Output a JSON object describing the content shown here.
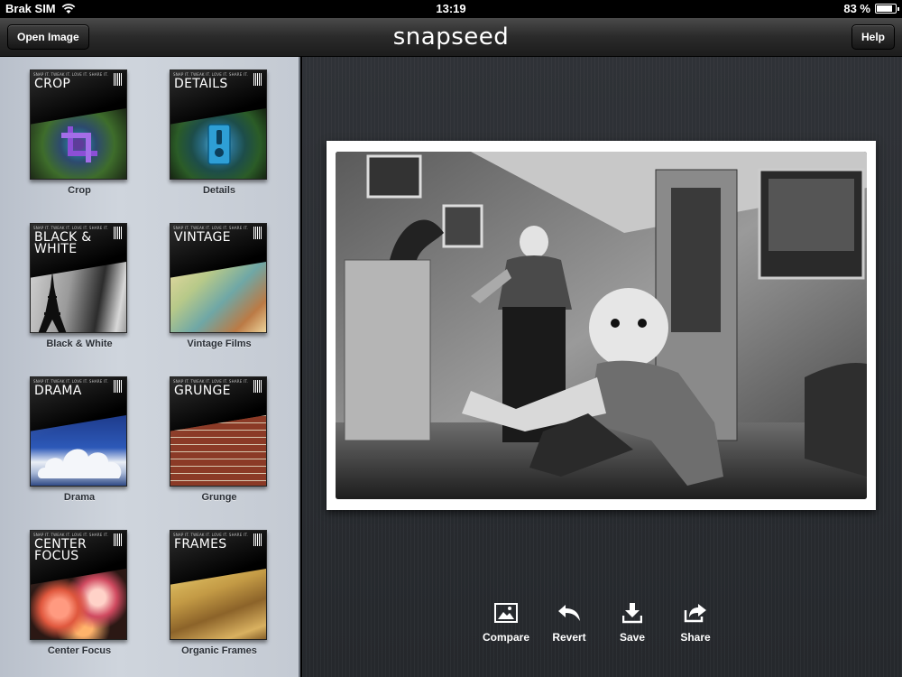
{
  "status_bar": {
    "carrier": "Brak SIM",
    "time": "13:19",
    "battery_percent": "83 %",
    "battery_level": 0.83
  },
  "navbar": {
    "open_image": "Open Image",
    "title": "snapseed",
    "help": "Help"
  },
  "thumb_tagline": "SNAP IT. TWEAK IT. LOVE IT. SHARE IT.",
  "tools": [
    {
      "title": "CROP",
      "label": "Crop"
    },
    {
      "title": "DETAILS",
      "label": "Details"
    },
    {
      "title": "BLACK & WHITE",
      "label": "Black & White"
    },
    {
      "title": "VINTAGE",
      "label": "Vintage Films"
    },
    {
      "title": "DRAMA",
      "label": "Drama"
    },
    {
      "title": "GRUNGE",
      "label": "Grunge"
    },
    {
      "title": "CENTER FOCUS",
      "label": "Center Focus"
    },
    {
      "title": "FRAMES",
      "label": "Organic Frames"
    }
  ],
  "actions": {
    "compare": "Compare",
    "revert": "Revert",
    "save": "Save",
    "share": "Share"
  },
  "icons": {
    "wifi": "wifi-icon",
    "battery": "battery-icon",
    "compare": "image-icon",
    "revert": "undo-arrow-icon",
    "save": "download-icon",
    "share": "share-arrow-icon"
  }
}
